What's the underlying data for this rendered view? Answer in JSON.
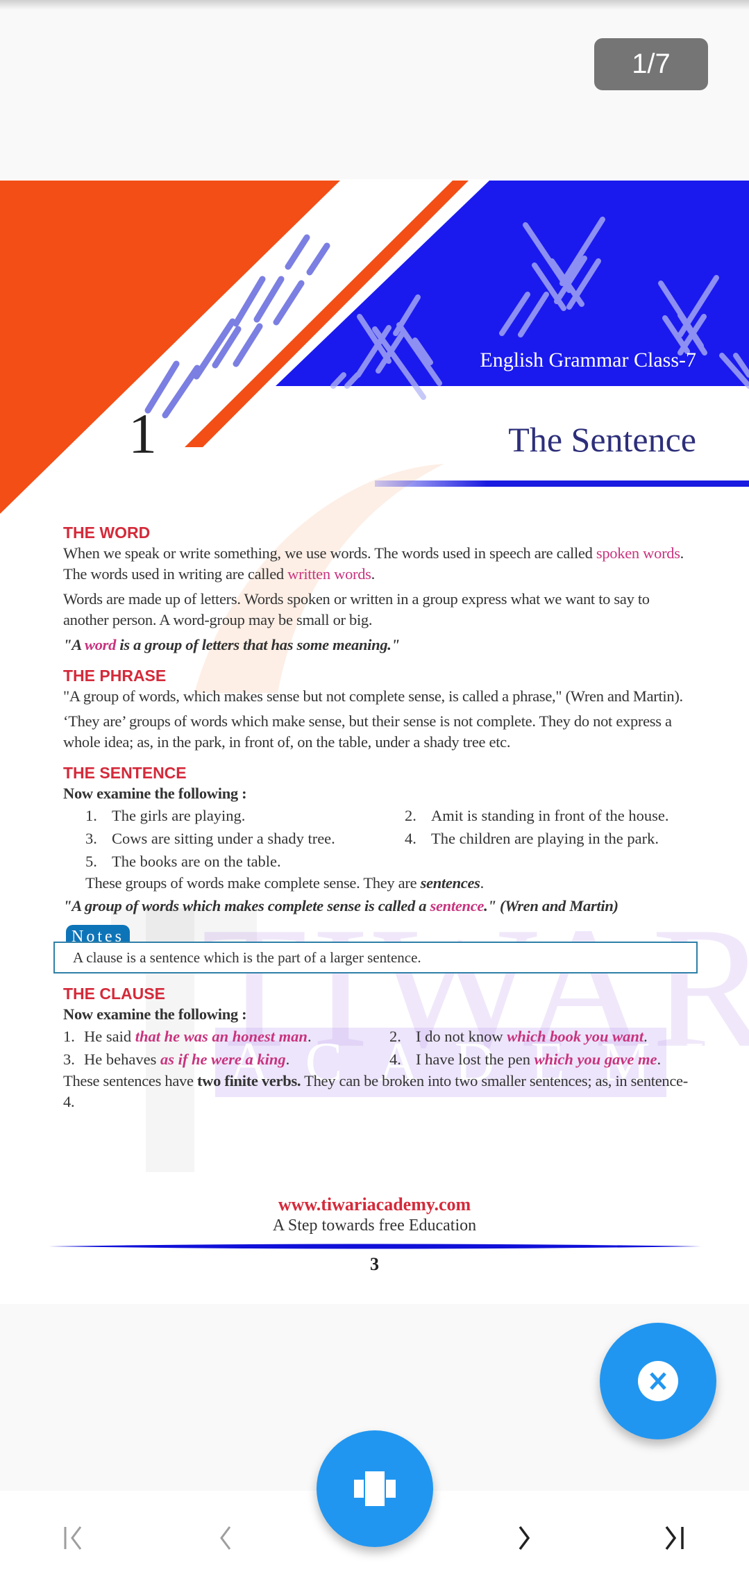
{
  "viewer": {
    "page_indicator": "1/7"
  },
  "document": {
    "series_title": "English Grammar Class-7",
    "chapter_number": "1",
    "chapter_title": "The Sentence",
    "watermark": {
      "line1": "TIWARI",
      "line2": "ACADEMY"
    },
    "sections": {
      "word": {
        "heading": "THE WORD",
        "p1_a": "When we speak or write something, we use words. The words used in speech are called ",
        "p1_hl1": "spoken words",
        "p1_b": ". The words used in writing are called ",
        "p1_hl2": "written words",
        "p1_c": ".",
        "p2": "Words are made up of letters. Words spoken or written in a group express what we want to say to another person. A word-group may be small or big.",
        "def_a": "\"A ",
        "def_hl": "word",
        "def_b": " is a group of letters that has some meaning.\""
      },
      "phrase": {
        "heading": "THE PHRASE",
        "p1": "\"A group of words, which makes sense but not complete sense, is called a phrase,\" (Wren and Martin).",
        "p2": "‘They are’ groups of words which make sense, but their sense is not complete. They do not express a whole idea; as, in the park, in front of, on the table, under a shady tree etc."
      },
      "sentence": {
        "heading": "THE SENTENCE",
        "intro": "Now examine the following :",
        "items": [
          {
            "num": "1.",
            "text": "The girls are playing."
          },
          {
            "num": "2.",
            "text": "Amit is standing in front of the house."
          },
          {
            "num": "3.",
            "text": "Cows are sitting under a shady tree."
          },
          {
            "num": "4.",
            "text": "The children are playing in the park."
          },
          {
            "num": "5.",
            "text": "The books are on the table."
          }
        ],
        "summary_a": "These groups of words make complete sense. They are ",
        "summary_b": "sentences",
        "summary_c": ".",
        "def_a": "\"A group of words which makes complete sense is called a ",
        "def_hl": "sentence",
        "def_b": ".\" (Wren and Martin)"
      },
      "notes": {
        "tab": "Notes",
        "text": "A clause is a sentence which is the part of a larger sentence."
      },
      "clause": {
        "heading": "THE CLAUSE",
        "intro": "Now examine the following :",
        "items": [
          {
            "num": "1.",
            "text": "He said ",
            "clause": "that he was an honest man",
            "end": "."
          },
          {
            "num": "2.",
            "text": "I do not know ",
            "clause": "which book you want",
            "end": "."
          },
          {
            "num": "3.",
            "text": "He behaves ",
            "clause": "as if he were a king",
            "end": "."
          },
          {
            "num": "4.",
            "text": "I have lost the pen ",
            "clause": "which you gave me",
            "end": "."
          }
        ],
        "summary_a": "These sentences have ",
        "summary_bold": "two finite verbs.",
        "summary_b": " They can be broken into two smaller sentences; as, in sentence-4."
      }
    },
    "footer": {
      "url": "www.tiwariacademy.com",
      "tagline": "A Step towards free Education",
      "page_number": "3"
    }
  },
  "controls": {
    "first_page": "first-page",
    "previous_page": "previous-page",
    "next_page": "next-page",
    "last_page": "last-page",
    "page_overview": "page-overview",
    "close": "close"
  },
  "colors": {
    "accent_blue": "#2196f0",
    "banner_orange": "#f24e16",
    "banner_blue": "#1a1aee",
    "heading_red": "#d42a3a",
    "highlight_pink": "#c8337e"
  }
}
